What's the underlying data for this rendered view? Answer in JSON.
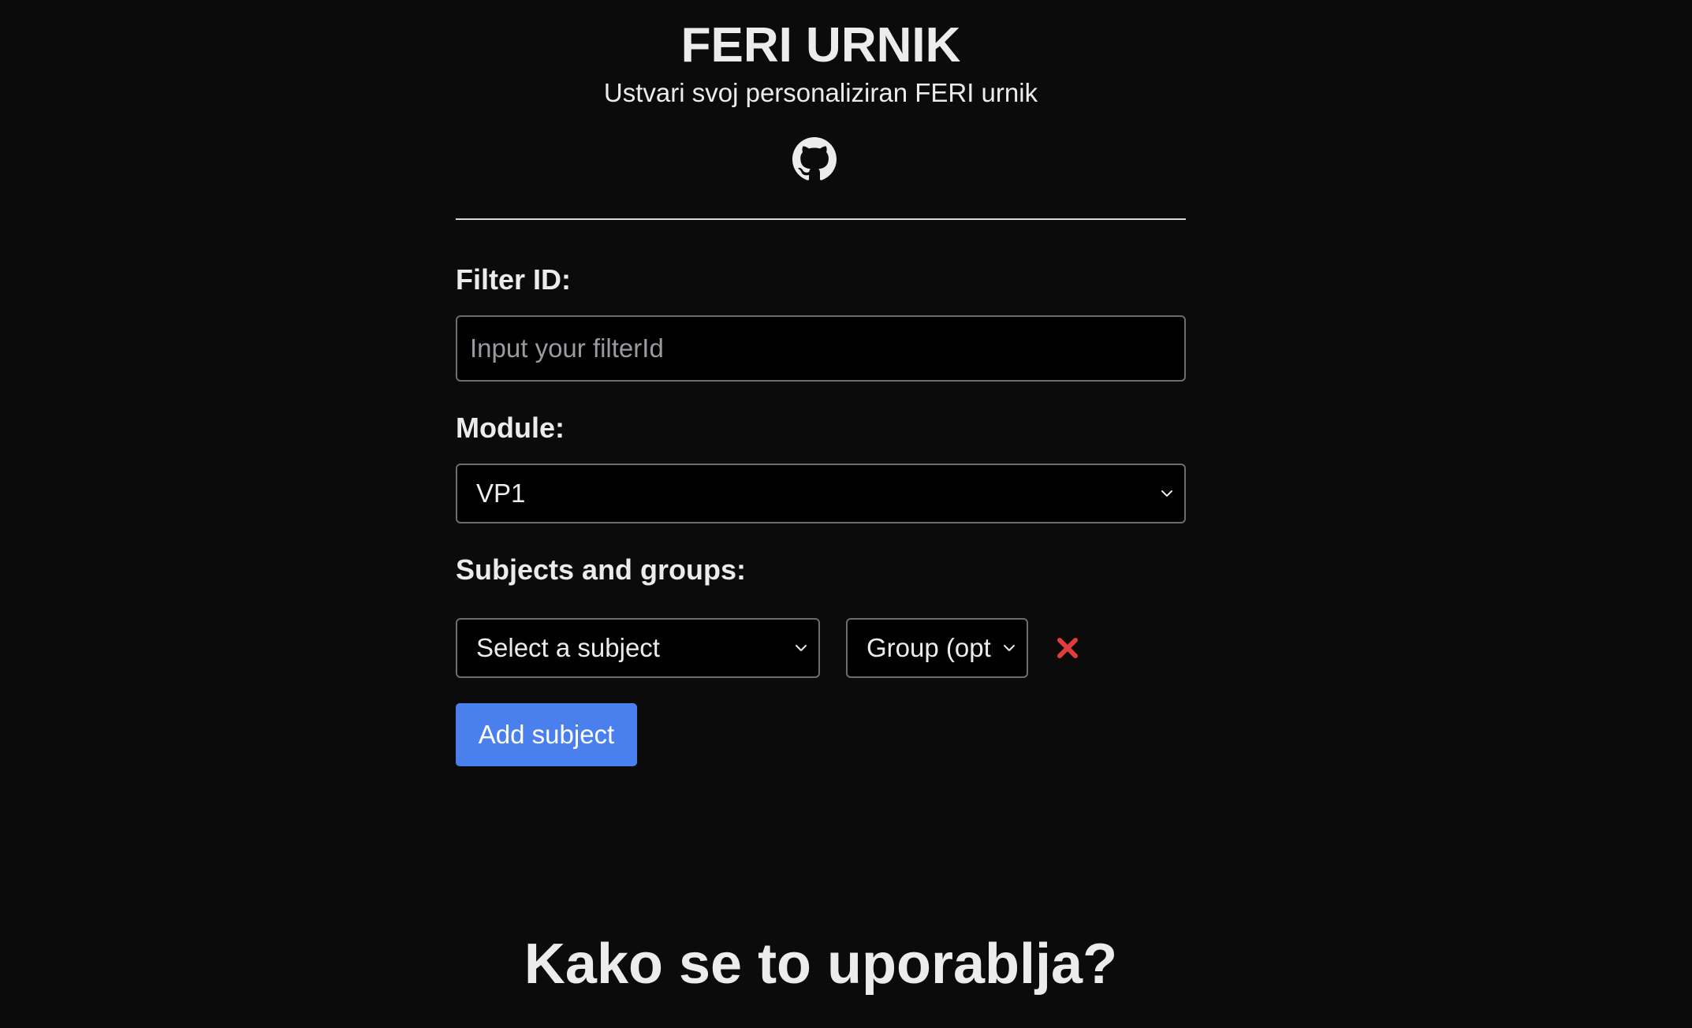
{
  "header": {
    "title": "FERI URNIK",
    "subtitle": "Ustvari svoj personaliziran FERI urnik",
    "github_icon": "github-icon"
  },
  "form": {
    "filter_label": "Filter ID:",
    "filter_placeholder": "Input your filterId",
    "filter_value": "",
    "module_label": "Module:",
    "module_value": "VP1",
    "subjects_label": "Subjects and groups:",
    "subject_placeholder": "Select a subject",
    "group_placeholder": "Group (opti",
    "remove_icon": "close-icon",
    "add_button_label": "Add subject"
  },
  "section": {
    "howto_title": "Kako se to uporablja?"
  },
  "colors": {
    "background": "#0b0b0b",
    "text": "#ececec",
    "accent": "#4a80ee",
    "danger": "#e03c3c",
    "border": "#6c6c72"
  }
}
